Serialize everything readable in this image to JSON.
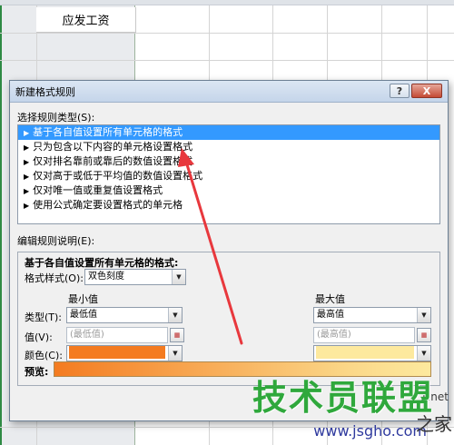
{
  "sheet": {
    "header_cell": "应发工资"
  },
  "dialog": {
    "title": "新建格式规则",
    "help_label": "?",
    "close_label": "X",
    "rule_type_label": "选择规则类型(S):",
    "rule_types": [
      "基于各自值设置所有单元格的格式",
      "只为包含以下内容的单元格设置格式",
      "仅对排名靠前或靠后的数值设置格式",
      "仅对高于或低于平均值的数值设置格式",
      "仅对唯一值或重复值设置格式",
      "使用公式确定要设置格式的单元格"
    ],
    "selected_index": 0,
    "edit_desc_label": "编辑规则说明(E):",
    "desc_heading": "基于各自值设置所有单元格的格式:",
    "format_style_label": "格式样式(O):",
    "format_style_value": "双色刻度",
    "min_label": "最小值",
    "max_label": "最大值",
    "type_label": "类型(T):",
    "value_label": "值(V):",
    "color_label": "颜色(C):",
    "min_type": "最低值",
    "max_type": "最高值",
    "min_value_placeholder": "(最低值)",
    "max_value_placeholder": "(最高值)",
    "min_color": "#f47b20",
    "max_color": "#fde99e",
    "preview_label": "预览:"
  },
  "watermark": {
    "brand": "技术员联盟",
    "url": "www.jsgho.com",
    "net": "1.net",
    "zhi": "之家"
  },
  "colors": {
    "selection_blue": "#3399ff",
    "arrow_red": "#e8383d",
    "watermark_green": "#2fa83c"
  }
}
